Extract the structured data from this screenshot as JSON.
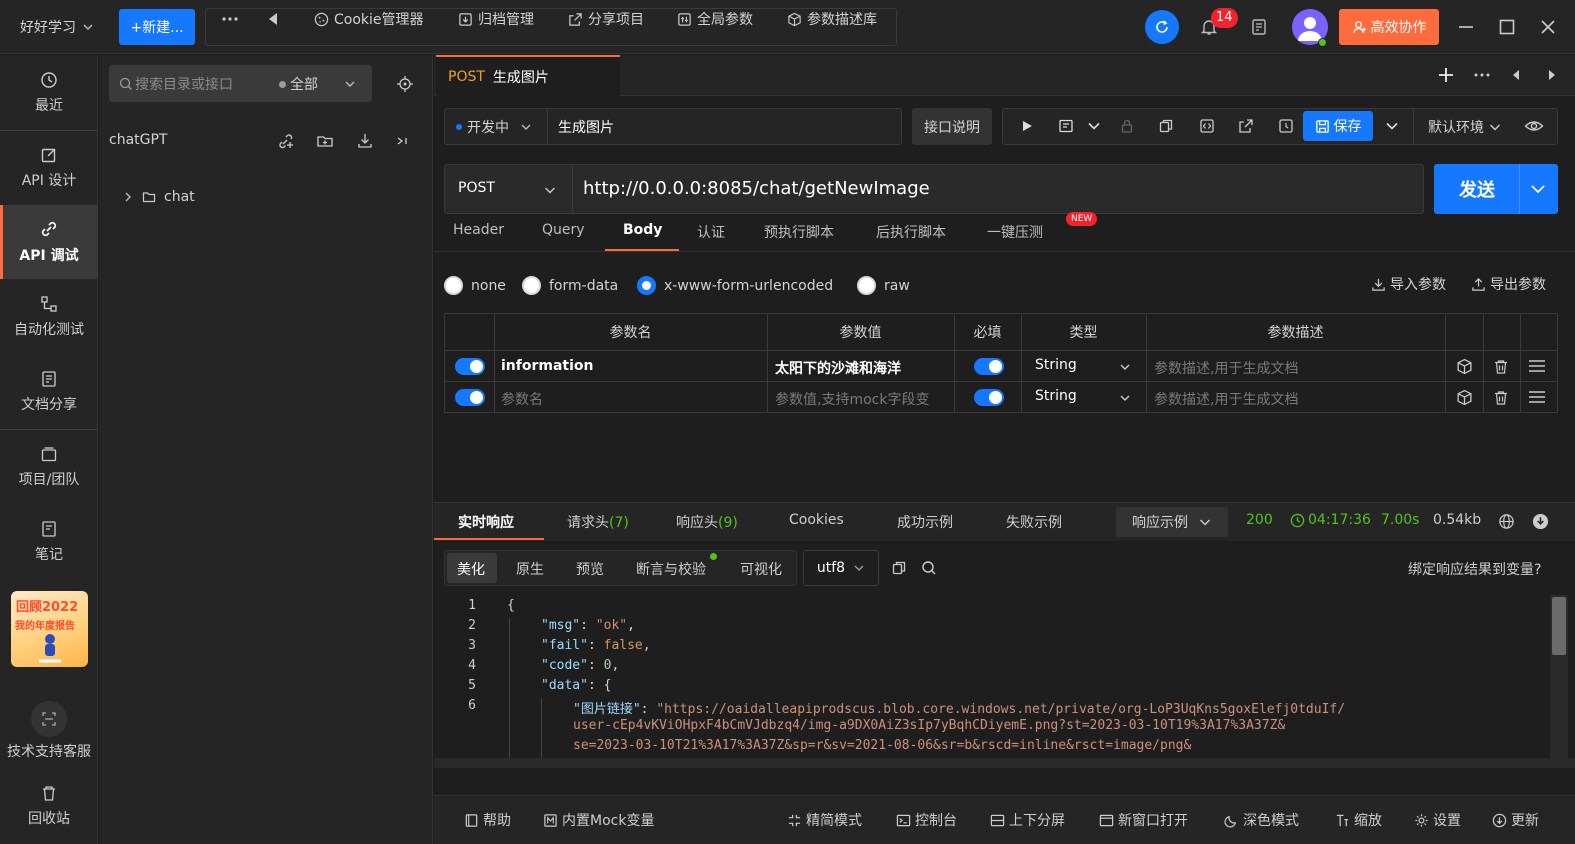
{
  "topbar": {
    "workspace": "好好学习",
    "new_button": "+新建...",
    "tools": [
      "Cookie管理器",
      "归档管理",
      "分享项目",
      "全局参数",
      "参数描述库"
    ],
    "notification_count": "14",
    "collab_button": "高效协作"
  },
  "nav": {
    "items": [
      "最近",
      "API 设计",
      "API 调试",
      "自动化测试",
      "文档分享",
      "项目/团队",
      "笔记"
    ],
    "active": "API 调试",
    "promo_title": "回顾2022",
    "promo_sub": "我的年度报告",
    "support": "技术支持客服",
    "trash": "回收站"
  },
  "tree": {
    "search_placeholder": "搜索目录或接口",
    "scope": "全部",
    "project": "chatGPT",
    "folder": "chat"
  },
  "tab": {
    "method": "POST",
    "name": "生成图片"
  },
  "api": {
    "status": "开发中",
    "name": "生成图片",
    "doc_button": "接口说明",
    "save_button": "保存",
    "environment": "默认环境"
  },
  "request": {
    "method": "POST",
    "url": "http://0.0.0.0:8085/chat/getNewImage",
    "send_button": "发送"
  },
  "req_tabs": [
    "Header",
    "Query",
    "Body",
    "认证",
    "预执行脚本",
    "后执行脚本",
    "一键压测"
  ],
  "new_badge": "NEW",
  "body_types": [
    "none",
    "form-data",
    "x-www-form-urlencoded",
    "raw"
  ],
  "body_type_selected": "x-www-form-urlencoded",
  "import_button": "导入参数",
  "export_button": "导出参数",
  "params": {
    "headers": [
      "参数名",
      "参数值",
      "必填",
      "类型",
      "参数描述"
    ],
    "rows": [
      {
        "name": "information",
        "value": "太阳下的沙滩和海洋",
        "type": "String",
        "desc_placeholder": "参数描述,用于生成文档"
      }
    ],
    "empty_row": {
      "name_placeholder": "参数名",
      "value_placeholder": "参数值,支持mock字段变",
      "type": "String",
      "desc_placeholder": "参数描述,用于生成文档"
    }
  },
  "response": {
    "tabs": [
      "实时响应",
      "请求头",
      "响应头",
      "Cookies",
      "成功示例",
      "失败示例"
    ],
    "req_header_count": "(7)",
    "resp_header_count": "(9)",
    "example_select": "响应示例",
    "status_code": "200",
    "time": "04:17:36",
    "duration": "7.00s",
    "size": "0.54kb",
    "views": [
      "美化",
      "原生",
      "预览",
      "断言与校验",
      "可视化"
    ],
    "encoding": "utf8",
    "bind_link": "绑定响应结果到变量?",
    "code": {
      "line_numbers": [
        "1",
        "2",
        "3",
        "4",
        "5",
        "6"
      ],
      "open_brace": "{",
      "msg_key": "\"msg\"",
      "msg_val": "\"ok\"",
      "fail_key": "\"fail\"",
      "fail_val": "false",
      "code_key": "\"code\"",
      "code_val": "0",
      "data_key": "\"data\"",
      "img_key": "\"图片链接\"",
      "img_val_1": "\"https://oaidalleapiprodscus.blob.core.windows.net/private/org-LoP3UqKns5goxElefj0tduIf/",
      "img_val_2": "user-cEp4vKViOHpxF4bCmVJdbzq4/img-a9DX0AiZ3sIp7yBqhCDiyemE.png?st=2023-03-10T19%3A17%3A37Z&",
      "img_val_3": "se=2023-03-10T21%3A17%3A37Z&sp=r&sv=2021-08-06&sr=b&rscd=inline&rsct=image/png&"
    }
  },
  "footer": [
    "帮助",
    "内置Mock变量",
    "精简模式",
    "控制台",
    "上下分屏",
    "新窗口打开",
    "深色模式",
    "缩放",
    "设置",
    "更新"
  ]
}
